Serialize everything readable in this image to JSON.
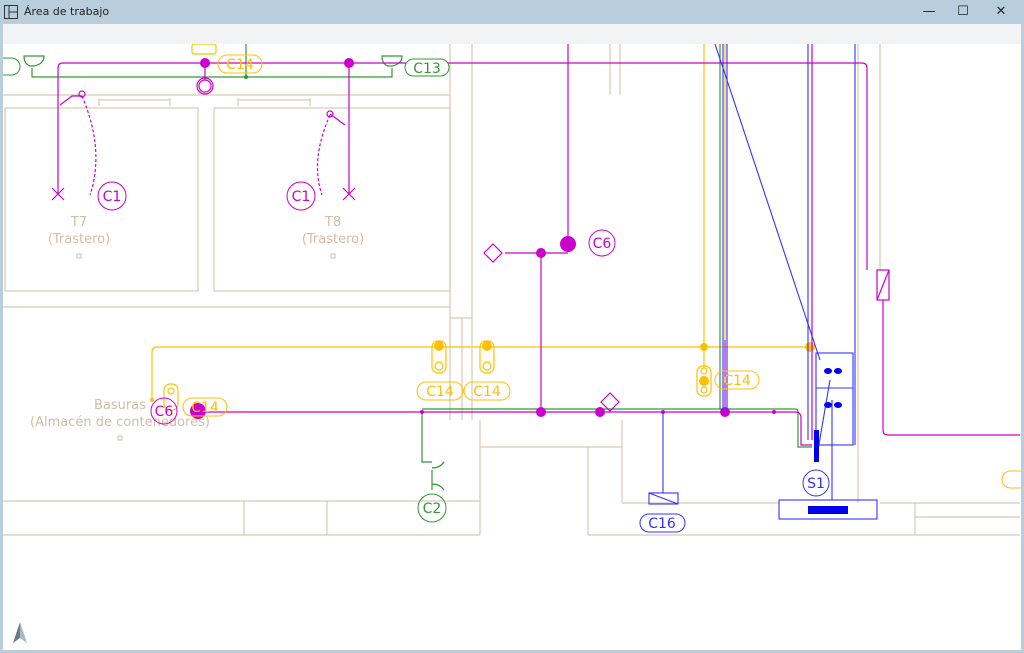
{
  "window": {
    "title": "Área de trabajo",
    "minimize_icon": "minimize-icon",
    "maximize_icon": "maximize-icon",
    "close_icon": "close-icon"
  },
  "colors": {
    "walls": "#dcc8b4",
    "lighting": "#cc00cc",
    "sockets": "#339933",
    "emergency": "#ffc000",
    "telecom": "#3333ff",
    "room_text": "#d2bca8"
  },
  "rooms": [
    {
      "name": "T7",
      "use": "(Trastero)"
    },
    {
      "name": "T8",
      "use": "(Trastero)"
    },
    {
      "name": "Basuras",
      "use": "(Almacén de contenedores)"
    }
  ],
  "circuit_labels": {
    "c1_left": "C1",
    "c1_right": "C1",
    "c6_center": "C6",
    "c6_left": "C6",
    "c14_top": "C14",
    "c14_left": "C14",
    "c14_mid_a": "C14",
    "c14_mid_b": "C14",
    "c14_right": "C14",
    "c13": "C13",
    "c2": "C2",
    "c16": "C16",
    "s1": "S1"
  },
  "compass_icon": "north-arrow-icon"
}
